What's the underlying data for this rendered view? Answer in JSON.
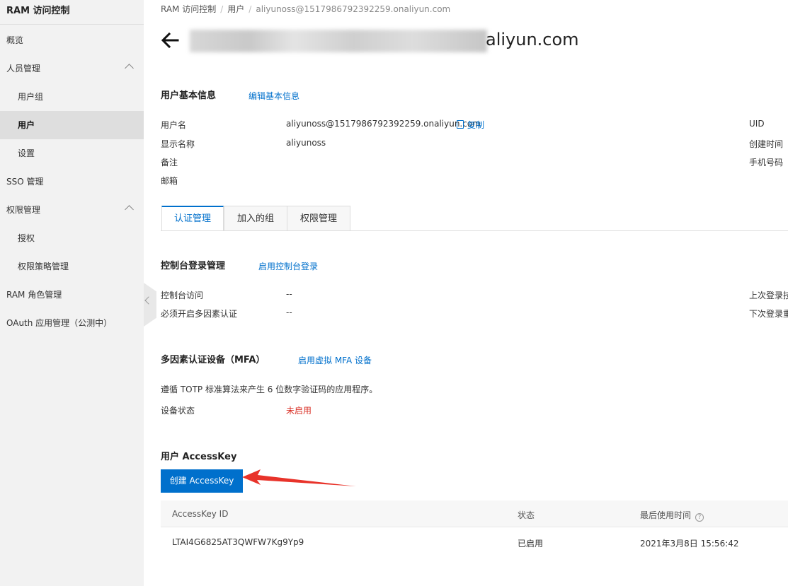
{
  "sidebar": {
    "title": "RAM 访问控制",
    "items": [
      {
        "label": "概览"
      },
      {
        "label": "人员管理"
      },
      {
        "label": "用户组"
      },
      {
        "label": "用户"
      },
      {
        "label": "设置"
      },
      {
        "label": "SSO 管理"
      },
      {
        "label": "权限管理"
      },
      {
        "label": "授权"
      },
      {
        "label": "权限策略管理"
      },
      {
        "label": "RAM 角色管理"
      },
      {
        "label": "OAuth 应用管理（公测中）"
      }
    ]
  },
  "breadcrumb": {
    "items": [
      "RAM 访问控制",
      "用户",
      "aliyunoss@1517986792392259.onaliyun.com"
    ],
    "separator": "/"
  },
  "header": {
    "title_visible_tail": "aliyun.com"
  },
  "basic_info": {
    "heading": "用户基本信息",
    "edit_link": "编辑基本信息",
    "username_label": "用户名",
    "username_value": "aliyunoss@1517986792392259.onaliyun.com",
    "copy_label": "复制",
    "display_name_label": "显示名称",
    "display_name_value": "aliyunoss",
    "note_label": "备注",
    "email_label": "邮箱",
    "uid_label": "UID",
    "created_label": "创建时间",
    "phone_label": "手机号码"
  },
  "tabs": [
    {
      "label": "认证管理",
      "active": true
    },
    {
      "label": "加入的组",
      "active": false
    },
    {
      "label": "权限管理",
      "active": false
    }
  ],
  "console_login": {
    "heading": "控制台登录管理",
    "enable_link": "启用控制台登录",
    "access_label": "控制台访问",
    "access_value": "--",
    "mfa_required_label": "必须开启多因素认证",
    "mfa_required_value": "--",
    "last_login_label": "上次登录技",
    "next_login_label": "下次登录重"
  },
  "mfa": {
    "heading": "多因素认证设备（MFA）",
    "enable_link": "启用虚拟 MFA 设备",
    "description": "遵循 TOTP 标准算法来产生 6 位数字验证码的应用程序。",
    "status_label": "设备状态",
    "status_value": "未启用",
    "status_color": "#d93026"
  },
  "accesskey": {
    "heading": "用户 AccessKey",
    "create_button": "创建 AccessKey",
    "columns": [
      "AccessKey ID",
      "状态",
      "最后使用时间"
    ],
    "rows": [
      {
        "id": "LTAI4G6825AT3QWFW7Kg9Yp9",
        "status": "已启用",
        "last_used": "2021年3月8日 15:56:42"
      }
    ]
  },
  "colors": {
    "accent": "#0070cc",
    "annotation_arrow": "#e8332a",
    "sidebar_bg": "#f2f2f2"
  }
}
